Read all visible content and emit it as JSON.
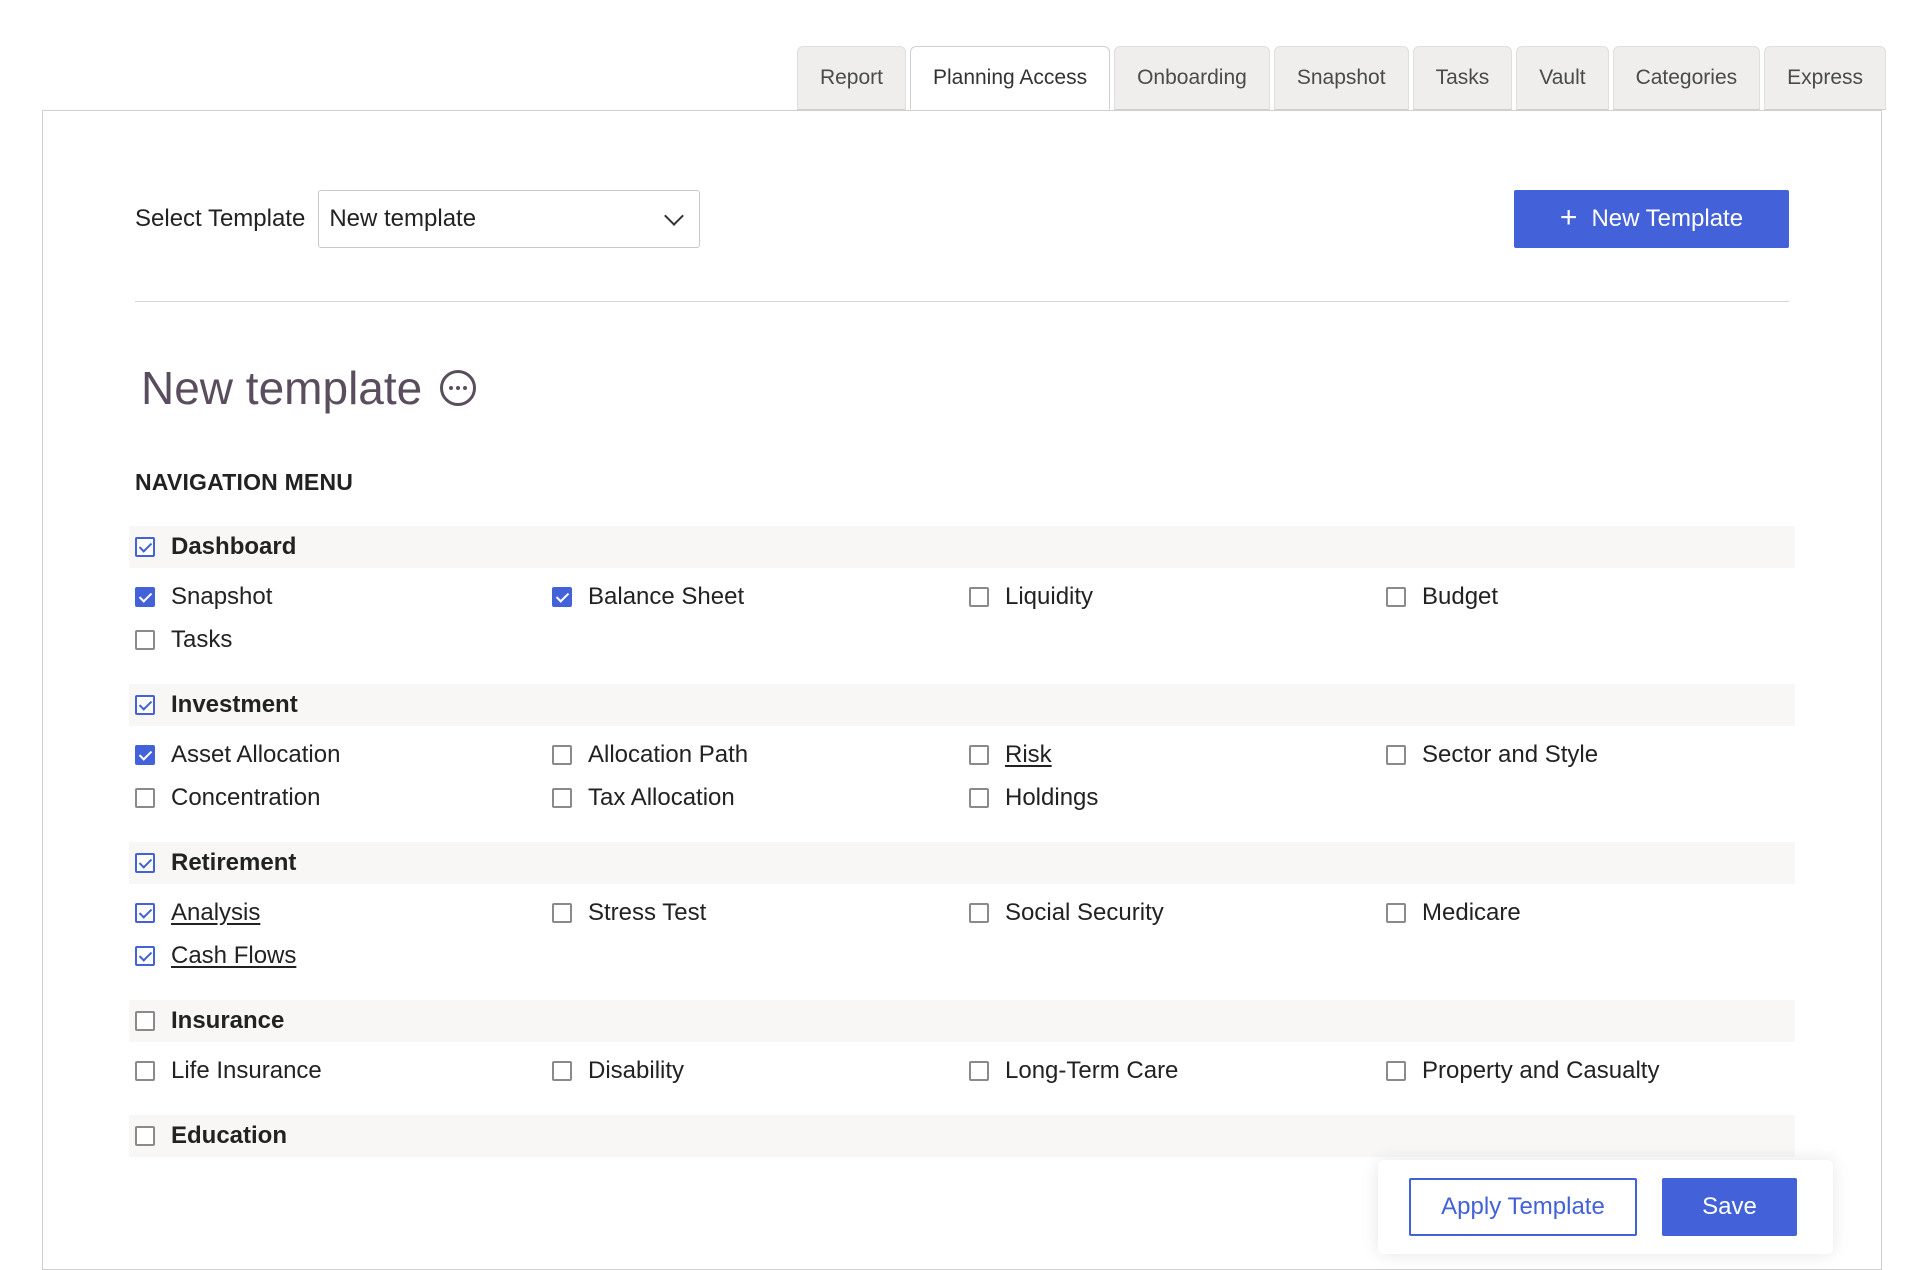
{
  "tabs": [
    {
      "label": "Report",
      "active": false
    },
    {
      "label": "Planning Access",
      "active": true
    },
    {
      "label": "Onboarding",
      "active": false
    },
    {
      "label": "Snapshot",
      "active": false
    },
    {
      "label": "Tasks",
      "active": false
    },
    {
      "label": "Vault",
      "active": false
    },
    {
      "label": "Categories",
      "active": false
    },
    {
      "label": "Express",
      "active": false
    }
  ],
  "template_select": {
    "label": "Select Template",
    "value": "New template",
    "chevron_icon": "chevron-down-icon"
  },
  "new_template_button": {
    "icon": "plus-icon",
    "icon_glyph": "+",
    "label": "New Template"
  },
  "page": {
    "title": "New template",
    "more_icon": "more-options-icon",
    "nav_heading": "NAVIGATION MENU"
  },
  "colors": {
    "accent": "#4361d8",
    "title": "#5a4d5e",
    "section_bg": "#f8f7f6"
  },
  "sections": [
    {
      "label": "Dashboard",
      "checked": true,
      "items": [
        {
          "label": "Snapshot",
          "checked": true,
          "style": "filled",
          "underlined": false
        },
        {
          "label": "Balance Sheet",
          "checked": true,
          "style": "filled",
          "underlined": false
        },
        {
          "label": "Liquidity",
          "checked": false,
          "underlined": false
        },
        {
          "label": "Budget",
          "checked": false,
          "underlined": false
        },
        {
          "label": "Tasks",
          "checked": false,
          "underlined": false
        }
      ]
    },
    {
      "label": "Investment",
      "checked": true,
      "items": [
        {
          "label": "Asset Allocation",
          "checked": true,
          "style": "filled",
          "underlined": false
        },
        {
          "label": "Allocation Path",
          "checked": false,
          "underlined": false
        },
        {
          "label": "Risk",
          "checked": false,
          "underlined": true
        },
        {
          "label": "Sector and Style",
          "checked": false,
          "underlined": false
        },
        {
          "label": "Concentration",
          "checked": false,
          "underlined": false
        },
        {
          "label": "Tax Allocation",
          "checked": false,
          "underlined": false
        },
        {
          "label": "Holdings",
          "checked": false,
          "underlined": false
        }
      ]
    },
    {
      "label": "Retirement",
      "checked": true,
      "items": [
        {
          "label": "Analysis",
          "checked": true,
          "style": "outline",
          "underlined": true
        },
        {
          "label": "Stress Test",
          "checked": false,
          "underlined": false
        },
        {
          "label": "Social Security",
          "checked": false,
          "underlined": false
        },
        {
          "label": "Medicare",
          "checked": false,
          "underlined": false
        },
        {
          "label": "Cash Flows",
          "checked": true,
          "style": "outline",
          "underlined": true
        }
      ]
    },
    {
      "label": "Insurance",
      "checked": false,
      "items": [
        {
          "label": "Life Insurance",
          "checked": false,
          "underlined": false
        },
        {
          "label": "Disability",
          "checked": false,
          "underlined": false
        },
        {
          "label": "Long-Term Care",
          "checked": false,
          "underlined": false
        },
        {
          "label": "Property and Casualty",
          "checked": false,
          "underlined": false
        }
      ]
    },
    {
      "label": "Education",
      "checked": false,
      "items": []
    }
  ],
  "actions": {
    "apply_label": "Apply Template",
    "save_label": "Save"
  }
}
